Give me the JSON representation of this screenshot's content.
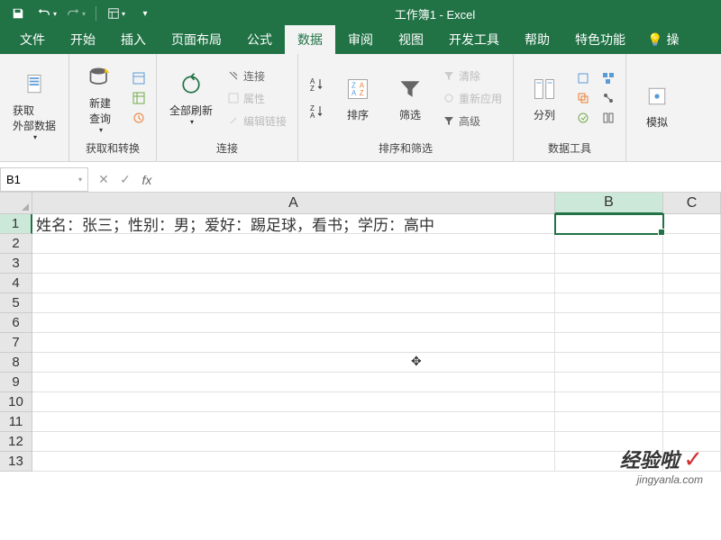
{
  "title": "工作簿1 - Excel",
  "tabs": {
    "file": "文件",
    "home": "开始",
    "insert": "插入",
    "pageLayout": "页面布局",
    "formulas": "公式",
    "data": "数据",
    "review": "审阅",
    "view": "视图",
    "developer": "开发工具",
    "help": "帮助",
    "special": "特色功能",
    "tellMe": "操"
  },
  "ribbon": {
    "getExternal": {
      "label": "获取\n外部数据",
      "group": ""
    },
    "newQuery": {
      "label": "新建\n查询",
      "group": "获取和转换"
    },
    "refreshAll": {
      "label": "全部刷新",
      "group": "连接"
    },
    "connections": "连接",
    "properties": "属性",
    "editLinks": "编辑链接",
    "sort": "排序",
    "filter": "筛选",
    "clear": "清除",
    "reapply": "重新应用",
    "advanced": "高级",
    "sortFilterGroup": "排序和筛选",
    "textToColumns": "分列",
    "dataToolsGroup": "数据工具",
    "simulate": "模拟"
  },
  "nameBox": "B1",
  "cellA1": "姓名：张三；性别：男；爱好：踢足球，看书；学历：高中",
  "cols": [
    "A",
    "B",
    "C"
  ],
  "rows": [
    "1",
    "2",
    "3",
    "4",
    "5",
    "6",
    "7",
    "8",
    "9",
    "10",
    "11",
    "12",
    "13"
  ],
  "watermark": {
    "main": "经验啦",
    "sub": "jingyanla.com"
  }
}
